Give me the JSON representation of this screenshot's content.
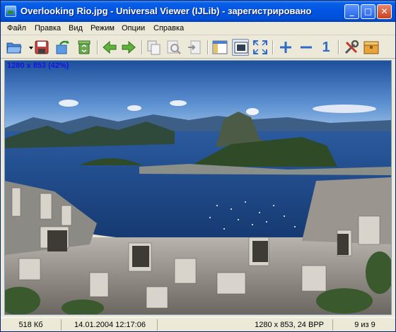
{
  "window": {
    "title": "Overlooking Rio.jpg - Universal Viewer (IJLib) - зарегистрировано",
    "minimize": "_",
    "maximize": "□",
    "close": "✕"
  },
  "menu": {
    "items": [
      "Файл",
      "Правка",
      "Вид",
      "Режим",
      "Опции",
      "Справка"
    ]
  },
  "toolbar": {
    "icons": [
      "open-icon",
      "dropdown-arrow-icon",
      "save-icon",
      "rotate-icon",
      "recycle-bin-icon",
      "previous-arrow-icon",
      "next-arrow-icon",
      "copy-icon",
      "find-icon",
      "export-icon",
      "sidebar-panel-icon",
      "fit-window-icon",
      "fullscreen-icon",
      "zoom-in-icon",
      "zoom-out-icon",
      "actual-size-icon",
      "tools-icon",
      "archive-icon"
    ],
    "zoom_one_label": "1"
  },
  "viewer": {
    "overlay_info": "1280 x 853 (42%)"
  },
  "status": {
    "file_size": "518 Кб",
    "datetime": "14.01.2004 12:17:06",
    "image_info": "1280 x 853, 24 BPP",
    "position": "9 из 9"
  },
  "colors": {
    "title_bar": "#0054e3",
    "overlay_text": "#1414e6",
    "sky": "#2a5fa8",
    "water": "#1b3f7c"
  }
}
